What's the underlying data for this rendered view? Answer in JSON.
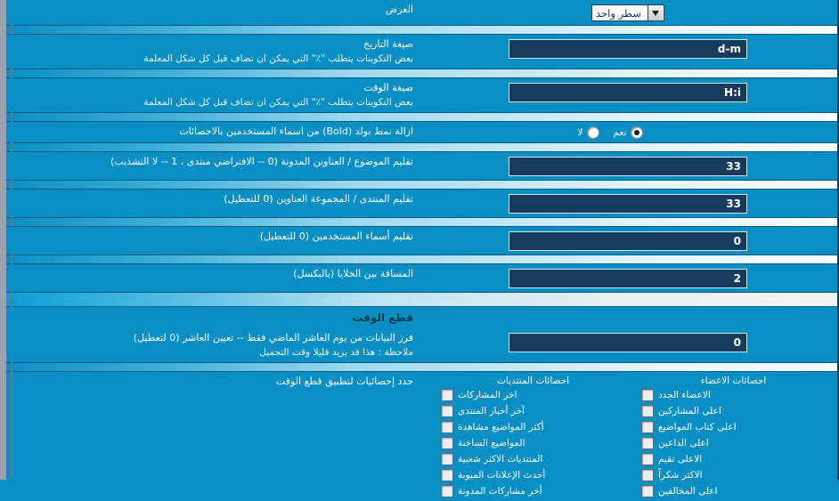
{
  "colors": {
    "background": "#0a8fc4",
    "input_bg": "#173a5e",
    "input_border": "#cfe9f6",
    "section_text": "#06384d"
  },
  "rows": [
    {
      "id": "display",
      "title": "العرض",
      "desc": "",
      "control": "select",
      "select_value": "سطر واحد"
    },
    {
      "id": "date-format",
      "title": "صيغة التاريخ",
      "desc": "بعض التكوينات يتطلب \"٪\" التي يمكن ان تضاف قبل كل شكل المعلمة",
      "control": "text",
      "value": "d-m"
    },
    {
      "id": "time-format",
      "title": "صيغة الوقت",
      "desc": "بعض التكوينات يتطلب \"٪\" التي يمكن ان تضاف قبل كل شكل المعلمة",
      "control": "text",
      "value": "H:i"
    },
    {
      "id": "remove-bold",
      "title": "ازالة نمط بولد (Bold) من اسماء المستخدمين بالاحصائات",
      "desc": "",
      "control": "radio",
      "options": [
        {
          "label": "نعم",
          "selected": true
        },
        {
          "label": "لا",
          "selected": false
        }
      ]
    },
    {
      "id": "trim-topic-titles",
      "title": "تقليم الموضوع / العناوين المدونة (0 -- الافتراضي منتدى ، 1 -- لا التشذيب)",
      "desc": "",
      "control": "text",
      "value": "33"
    },
    {
      "id": "trim-forum-titles",
      "title": "تقليم المنتدى / المجموعة العناوين (0 للتعطيل)",
      "desc": "",
      "control": "text",
      "value": "33"
    },
    {
      "id": "trim-usernames",
      "title": "تقليم أسماء المستخدمين (0 للتعطيل)",
      "desc": "",
      "control": "text",
      "value": "0"
    },
    {
      "id": "cell-spacing",
      "title": "المسافة بين الخلايا (بالبكسل)",
      "desc": "",
      "control": "text",
      "value": "2"
    }
  ],
  "section": {
    "heading": "قطع الوقت",
    "cutoff_row": {
      "id": "cutoff-days",
      "title": "فرز البيانات من يوم العاشر الماضي فقط -- تعيين العاشر (0 لتعطيل)",
      "desc": "ملاحظة : هذا قد يزيد قليلا وقت التحميل",
      "value": "0"
    }
  },
  "checkbox_panel": {
    "right_label": "حدد إحصائيات لتطبيق قطع الوقت",
    "columns": [
      {
        "id": "forum-stats",
        "header": "احصائات المنتديات",
        "items": [
          {
            "label": "اخر المشاركات",
            "checked": false
          },
          {
            "label": "آخر أخبار المنتدى",
            "checked": false
          },
          {
            "label": "أكثر المواضيع مشاهدة",
            "checked": false
          },
          {
            "label": "المواضيع الساخنة",
            "checked": false
          },
          {
            "label": "المنتديات الاكثر شعبية",
            "checked": false
          },
          {
            "label": "أحدث الإعلانات المبوبة",
            "checked": false
          },
          {
            "label": "أخر مشاركات المدونة",
            "checked": false
          }
        ]
      },
      {
        "id": "member-stats",
        "header": "احصائات الاعضاء",
        "items": [
          {
            "label": "الاعضاء الجدد",
            "checked": false
          },
          {
            "label": "اعلى المشاركين",
            "checked": false
          },
          {
            "label": "اعلى كتاب المواضيع",
            "checked": false
          },
          {
            "label": "اعلى الداعين",
            "checked": false
          },
          {
            "label": "الاعلى تقيم",
            "checked": false
          },
          {
            "label": "الاكثر شكراً",
            "checked": false
          },
          {
            "label": "اعلى المخالفين",
            "checked": false
          }
        ]
      }
    ]
  },
  "icons": {
    "dropdown_arrow": "chevron-down-icon"
  }
}
